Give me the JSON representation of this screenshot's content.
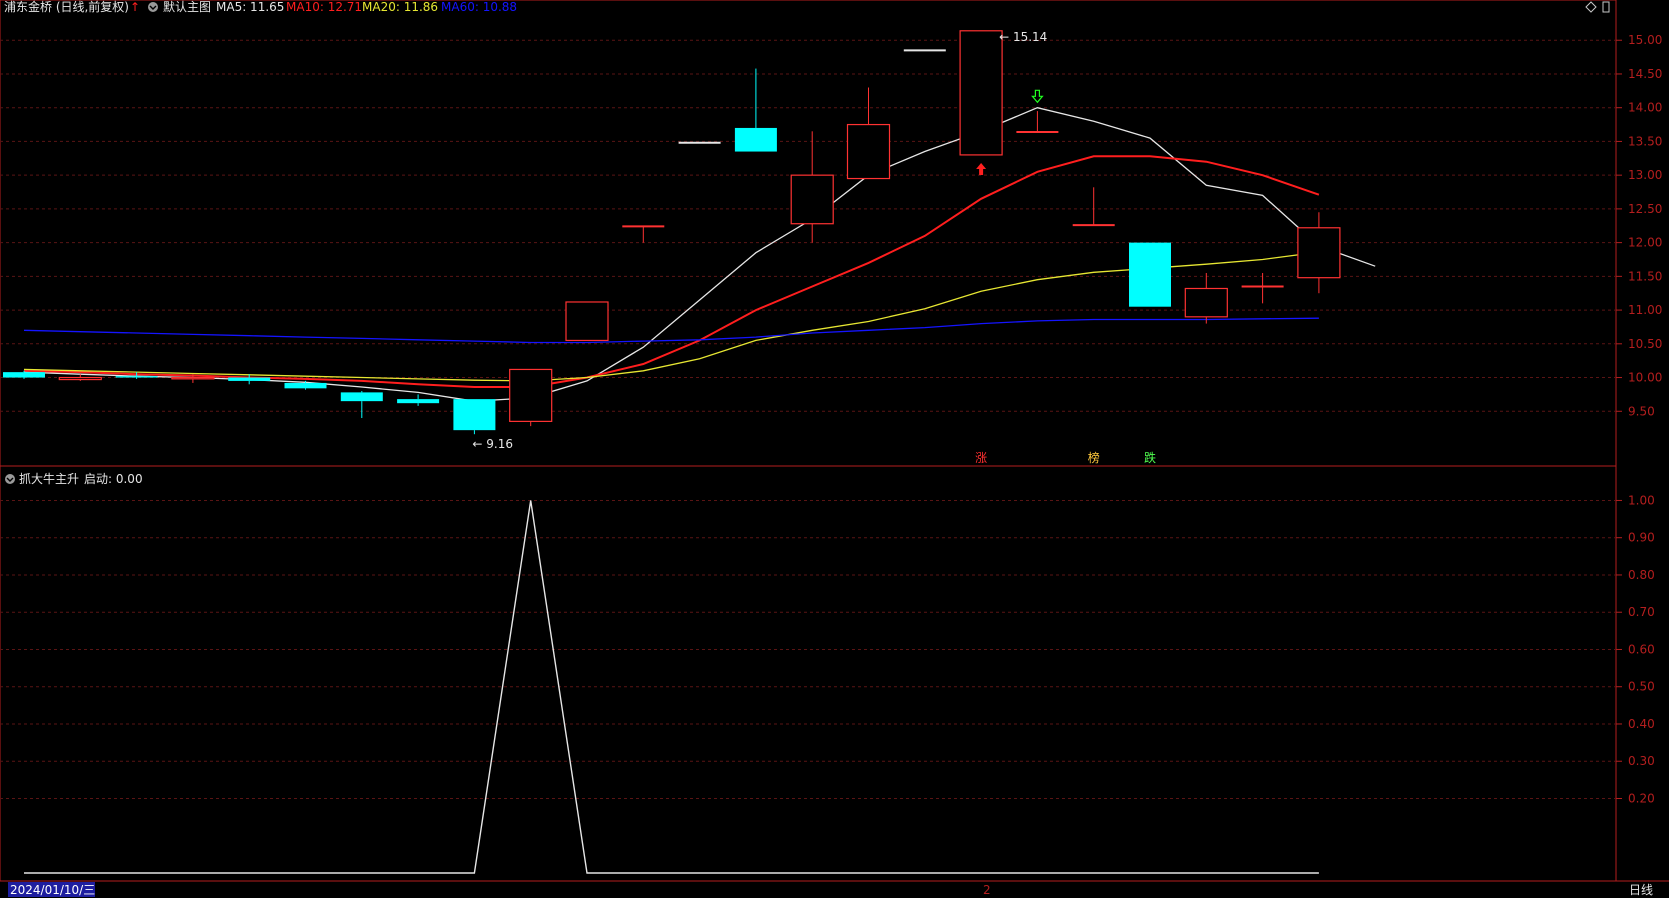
{
  "header": {
    "stock_title": "浦东金桥 (日线,前复权)",
    "main_label": "默认主图",
    "ma5_label": "MA5: 11.65",
    "ma10_label": "MA10: 12.71",
    "ma20_label": "MA20: 11.86",
    "ma60_label": "MA60: 10.88"
  },
  "sub_header": {
    "indicator_label": "抓大牛主升",
    "value_label": "启动: 0.00"
  },
  "footer": {
    "date_label": "2024/01/10/三",
    "marker_label": "2",
    "period_label": "日线"
  },
  "colors": {
    "up": "#ff3232",
    "down": "#00ffff",
    "ma5": "#e6e6e6",
    "ma10": "#ff1e1e",
    "ma20": "#e6e632",
    "ma60": "#1414ff",
    "axis": "#b41e1e",
    "grid": "#5a1414",
    "indicator": "#e6e6e6"
  },
  "chart_data": [
    {
      "type": "candlestick",
      "name": "main",
      "ylim": [
        9.0,
        15.3
      ],
      "y_ticks": [
        "9.50",
        "10.00",
        "10.50",
        "11.00",
        "11.50",
        "12.00",
        "12.50",
        "13.00",
        "13.50",
        "14.00",
        "14.50",
        "15.00"
      ],
      "max_label": "15.14",
      "min_label": "9.16",
      "candles": [
        {
          "o": 10.08,
          "c": 10.0,
          "h": 10.1,
          "l": 9.98
        },
        {
          "o": 9.97,
          "c": 10.0,
          "h": 10.05,
          "l": 9.95
        },
        {
          "o": 10.02,
          "c": 10.0,
          "h": 10.08,
          "l": 9.98
        },
        {
          "o": 9.98,
          "c": 10.0,
          "h": 10.05,
          "l": 9.92
        },
        {
          "o": 10.0,
          "c": 9.95,
          "h": 10.05,
          "l": 9.9
        },
        {
          "o": 9.92,
          "c": 9.84,
          "h": 9.95,
          "l": 9.82
        },
        {
          "o": 9.78,
          "c": 9.65,
          "h": 9.8,
          "l": 9.4
        },
        {
          "o": 9.68,
          "c": 9.62,
          "h": 9.75,
          "l": 9.58
        },
        {
          "o": 9.68,
          "c": 9.22,
          "h": 9.68,
          "l": 9.16
        },
        {
          "o": 9.35,
          "c": 10.12,
          "h": 10.12,
          "l": 9.28
        },
        {
          "o": 10.55,
          "c": 11.12,
          "h": 11.12,
          "l": 10.55
        },
        {
          "o": 12.24,
          "c": 12.24,
          "h": 12.24,
          "l": 12.0
        },
        {
          "o": 13.48,
          "c": 13.48,
          "h": 13.48,
          "l": 13.48
        },
        {
          "o": 13.7,
          "c": 13.35,
          "h": 14.58,
          "l": 13.35
        },
        {
          "o": 12.28,
          "c": 13.0,
          "h": 13.65,
          "l": 12.0
        },
        {
          "o": 12.95,
          "c": 13.75,
          "h": 14.3,
          "l": 12.95
        },
        {
          "o": 14.85,
          "c": 14.85,
          "h": 14.85,
          "l": 14.85
        },
        {
          "o": 13.3,
          "c": 15.14,
          "h": 15.14,
          "l": 13.3
        },
        {
          "o": 13.64,
          "c": 13.64,
          "h": 13.95,
          "l": 13.64
        },
        {
          "o": 12.26,
          "c": 12.26,
          "h": 12.82,
          "l": 12.26
        },
        {
          "o": 12.0,
          "c": 11.05,
          "h": 12.0,
          "l": 11.05
        },
        {
          "o": 10.9,
          "c": 11.32,
          "h": 11.55,
          "l": 10.8
        },
        {
          "o": 11.35,
          "c": 11.35,
          "h": 11.55,
          "l": 11.1
        },
        {
          "o": 11.48,
          "c": 12.22,
          "h": 12.45,
          "l": 11.25
        }
      ],
      "series": [
        {
          "key": "ma5",
          "values": [
            10.08,
            10.05,
            10.02,
            10.0,
            9.97,
            9.93,
            9.86,
            9.78,
            9.65,
            9.7,
            9.95,
            10.45,
            11.15,
            11.85,
            12.35,
            13.0,
            13.35,
            13.65,
            14.0,
            13.8,
            13.55,
            12.85,
            12.7,
            11.95,
            11.65
          ]
        },
        {
          "key": "ma10",
          "values": [
            10.1,
            10.08,
            10.05,
            10.03,
            10.0,
            9.98,
            9.95,
            9.9,
            9.86,
            9.86,
            10.0,
            10.2,
            10.55,
            11.0,
            11.35,
            11.7,
            12.1,
            12.65,
            13.05,
            13.28,
            13.28,
            13.2,
            13.0,
            12.71
          ]
        },
        {
          "key": "ma20",
          "values": [
            10.12,
            10.1,
            10.08,
            10.06,
            10.04,
            10.02,
            10.0,
            9.98,
            9.96,
            9.95,
            10.0,
            10.1,
            10.28,
            10.55,
            10.7,
            10.83,
            11.02,
            11.28,
            11.45,
            11.56,
            11.62,
            11.68,
            11.75,
            11.86
          ]
        },
        {
          "key": "ma60",
          "values": [
            10.7,
            10.68,
            10.66,
            10.64,
            10.62,
            10.6,
            10.58,
            10.56,
            10.54,
            10.52,
            10.52,
            10.54,
            10.56,
            10.6,
            10.66,
            10.7,
            10.74,
            10.8,
            10.84,
            10.86,
            10.86,
            10.86,
            10.87,
            10.88
          ]
        }
      ],
      "signals": [
        {
          "type": "up-arrow",
          "index": 17,
          "value": 13.18,
          "color": "#ff2020"
        },
        {
          "type": "down-arrow",
          "index": 18,
          "value": 14.08,
          "color": "#20ff20"
        }
      ],
      "markers": [
        {
          "text": "涨",
          "index": 17,
          "color": "#ff3030"
        },
        {
          "text": "榜",
          "index": 19,
          "color": "#ffc83c"
        },
        {
          "text": "跌",
          "index": 20,
          "color": "#50ff50"
        }
      ]
    },
    {
      "type": "line",
      "name": "indicator",
      "ylim": [
        0.0,
        1.02
      ],
      "y_ticks": [
        "0.20",
        "0.30",
        "0.40",
        "0.50",
        "0.60",
        "0.70",
        "0.80",
        "0.90",
        "1.00"
      ],
      "values": [
        0,
        0,
        0,
        0,
        0,
        0,
        0,
        0,
        0,
        1,
        0,
        0,
        0,
        0,
        0,
        0,
        0,
        0,
        0,
        0,
        0,
        0,
        0,
        0
      ]
    }
  ]
}
